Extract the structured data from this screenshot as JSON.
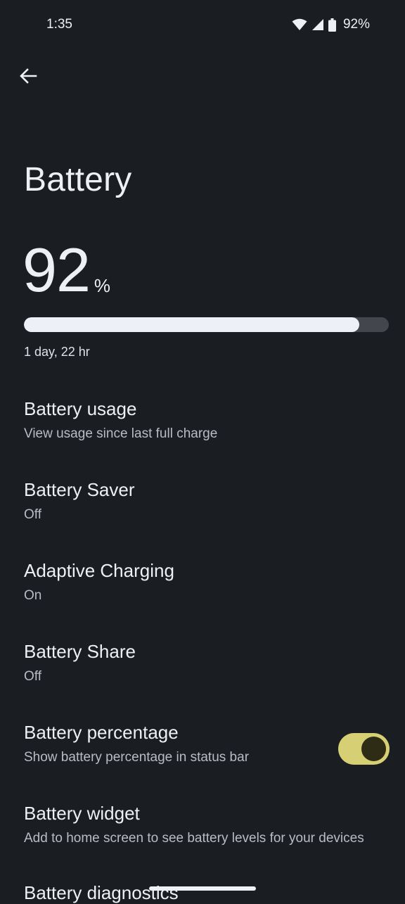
{
  "status_bar": {
    "time": "1:35",
    "battery_percent": "92%",
    "icons": [
      "wifi-icon",
      "cellular-signal-icon",
      "battery-icon"
    ]
  },
  "header": {
    "back_icon": "arrow-back-icon",
    "title": "Battery"
  },
  "battery": {
    "level_value": "92",
    "level_unit": "%",
    "level_fraction": 0.92,
    "time_remaining": "1 day, 22 hr"
  },
  "settings": {
    "items": [
      {
        "title": "Battery usage",
        "summary": "View usage since last full charge"
      },
      {
        "title": "Battery Saver",
        "summary": "Off"
      },
      {
        "title": "Adaptive Charging",
        "summary": "On"
      },
      {
        "title": "Battery Share",
        "summary": "Off"
      },
      {
        "title": "Battery percentage",
        "summary": "Show battery percentage in status bar",
        "toggle_on": true
      },
      {
        "title": "Battery widget",
        "summary": "Add to home screen to see battery levels for your devices"
      },
      {
        "title": "Battery diagnostics"
      }
    ]
  },
  "colors": {
    "background": "#1a1d22",
    "accent_toggle": "#d6cf73",
    "bar_fill": "#eef0f8",
    "bar_track": "#43464c"
  }
}
